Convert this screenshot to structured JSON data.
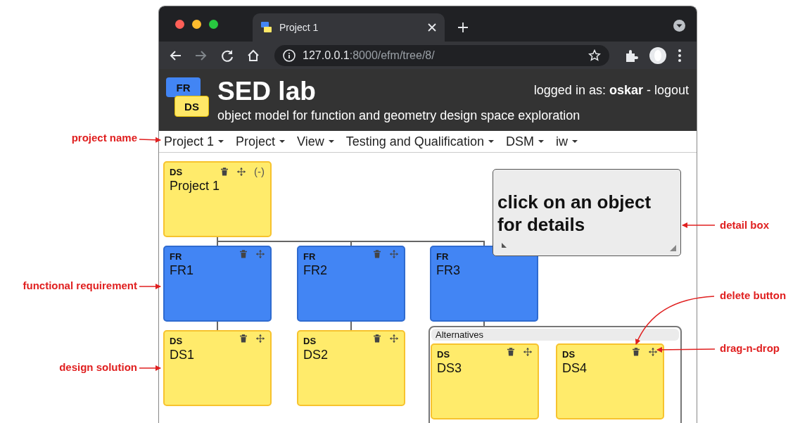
{
  "browser": {
    "tab": {
      "title": "Project 1"
    },
    "nav": [
      {
        "kind": "back",
        "disabled": false
      },
      {
        "kind": "forward",
        "disabled": true
      },
      {
        "kind": "reload",
        "disabled": false
      },
      {
        "kind": "home",
        "disabled": false
      }
    ],
    "address": {
      "host": "127.0.0.1",
      "rest": ":8000/efm/tree/8/"
    }
  },
  "header": {
    "logo_top": "FR",
    "logo_bottom": "DS",
    "title": "SED lab",
    "subtitle": "object model for function and geometry design space exploration",
    "login": "logged in as: **oskar** -",
    "logout": "logout"
  },
  "menu": [
    {
      "label": "Project 1"
    },
    {
      "label": "Project"
    },
    {
      "label": "View"
    },
    {
      "label": "Testing and Qualification"
    },
    {
      "label": "DSM"
    },
    {
      "label": "iw"
    }
  ],
  "tree": {
    "kind": "ds",
    "type_label": "DS",
    "name": "Project 1",
    "collapse": "(-)",
    "children": [
      {
        "kind": "fr",
        "type_label": "FR",
        "name": "FR1",
        "children": [
          {
            "kind": "ds",
            "type_label": "DS",
            "name": "DS1"
          }
        ]
      },
      {
        "kind": "fr",
        "type_label": "FR",
        "name": "FR2",
        "children": [
          {
            "kind": "ds",
            "type_label": "DS",
            "name": "DS2"
          }
        ]
      },
      {
        "kind": "fr",
        "type_label": "FR",
        "name": "FR3",
        "tools_hidden": true,
        "children": [
          {
            "kind": "alternatives",
            "label": "Alternatives",
            "children": [
              {
                "kind": "ds",
                "type_label": "DS",
                "name": "DS3"
              },
              {
                "kind": "ds",
                "type_label": "DS",
                "name": "DS4"
              }
            ]
          }
        ]
      }
    ]
  },
  "detail_box": {
    "text": "click on an object for details"
  },
  "annotations": [
    {
      "text": "project name"
    },
    {
      "text": "functional requirement"
    },
    {
      "text": "design solution"
    },
    {
      "text": "detail box"
    },
    {
      "text": "delete button"
    },
    {
      "text": "drag-n-drop"
    }
  ]
}
